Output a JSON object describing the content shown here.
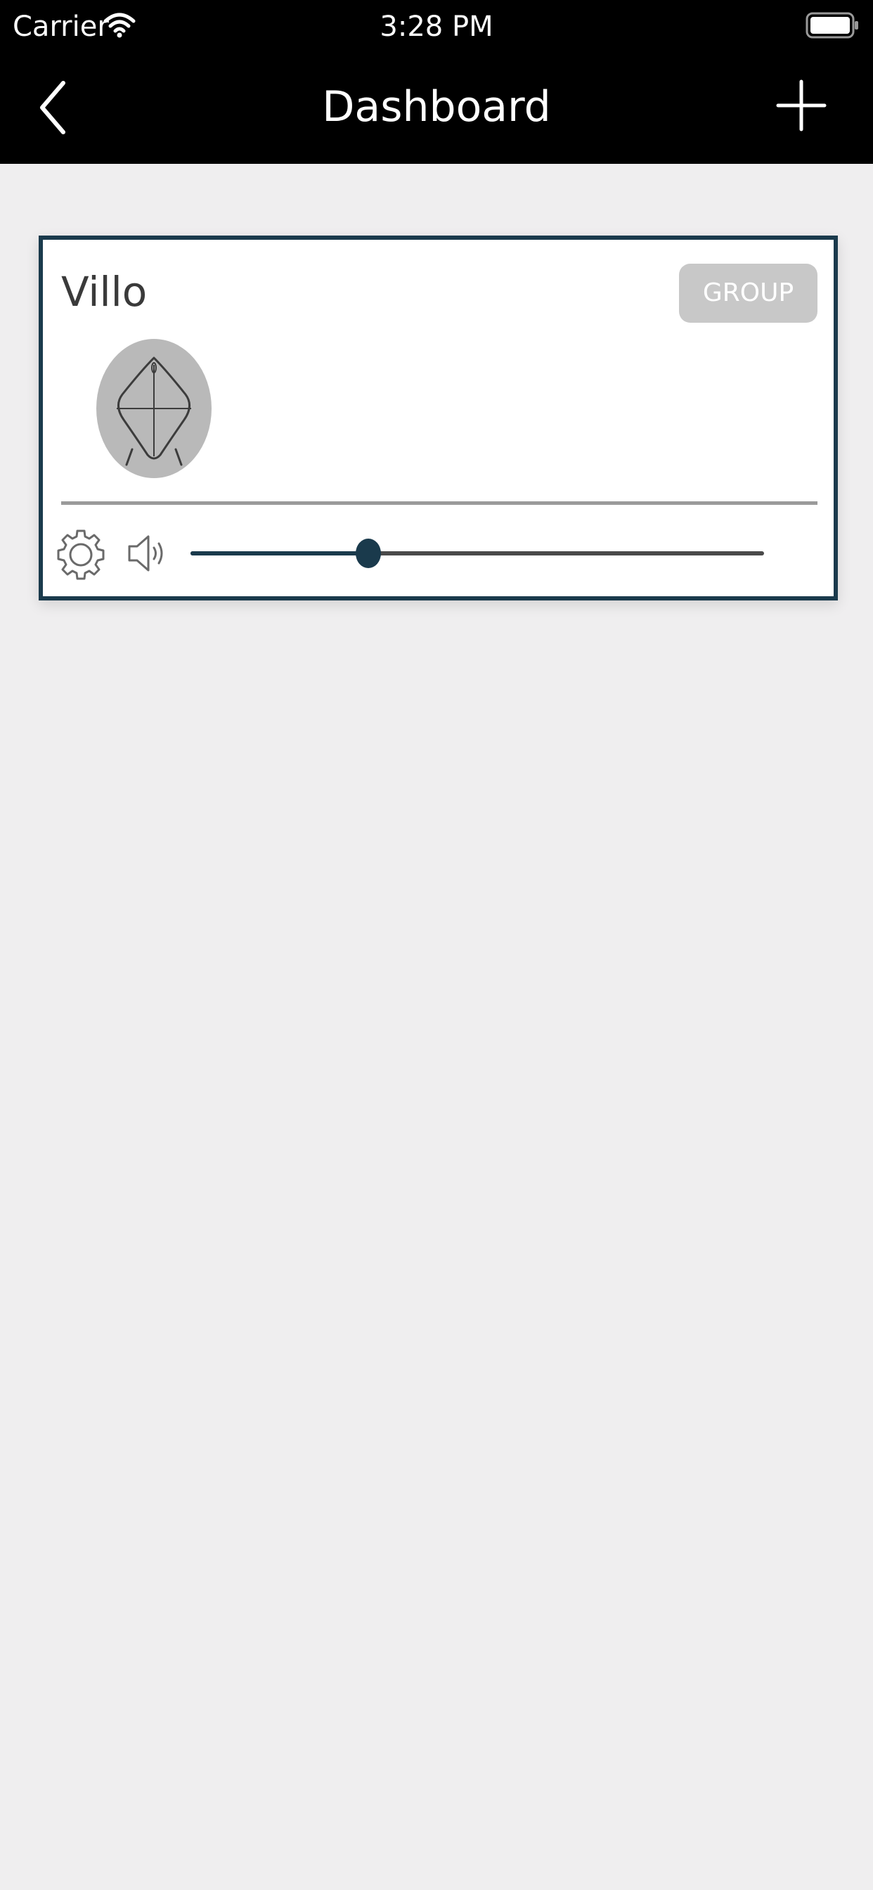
{
  "status_bar": {
    "carrier": "Carrier",
    "time": "3:28 PM"
  },
  "nav": {
    "title": "Dashboard",
    "back_icon": "chevron-left-icon",
    "add_icon": "plus-icon"
  },
  "device_card": {
    "name": "Villo",
    "group_label": "GROUP",
    "volume_fraction": 0.31,
    "icons": {
      "avatar": "device-speaker-icon",
      "settings": "gear-icon",
      "volume": "speaker-volume-icon"
    }
  },
  "colors": {
    "accent": "#1a3a4c",
    "header_bg": "#000000",
    "page_bg": "#efeeef",
    "group_button_bg": "#c8c8c8"
  }
}
